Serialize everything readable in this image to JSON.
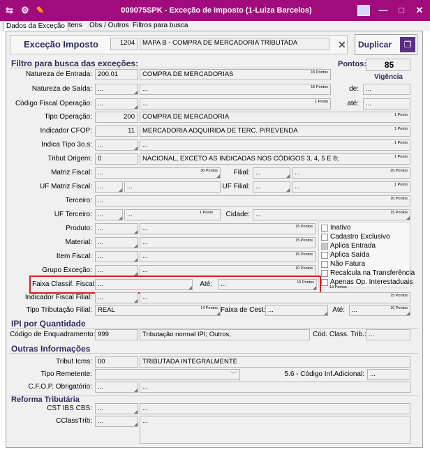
{
  "window": {
    "title": "009075SPK - Exceção de Imposto (1-Luiza Barcelos)",
    "minimize": "—",
    "maximize": "□",
    "close": "✕"
  },
  "tabs": [
    "Dados da Exceção",
    "Itens",
    "Obs / Outros",
    "Filtros para busca"
  ],
  "header": {
    "label": "Exceção Imposto",
    "code": "1204",
    "description": "MAPA B - COMPRA DE MERCADORIA TRIBUTADA",
    "clear": "✕",
    "duplicate": "Duplicar"
  },
  "filtro": {
    "title": "Filtro para busca das exceções:",
    "pontos_label": "Pontos:",
    "pontos_value": "85",
    "vigencia": "Vigência",
    "de_label": "de:",
    "de_value": "...",
    "ate_label": "até:",
    "ate_value": "...",
    "natureza_entrada": {
      "label": "Natureza de Entrada:",
      "code": "200.01",
      "desc": "COMPRA DE MERCADORIAS",
      "pts": "15 Pontos"
    },
    "natureza_saida": {
      "label": "Natureza de Saída:",
      "code": "...",
      "desc": "...",
      "pts": "15 Pontos"
    },
    "cfop": {
      "label": "Código Fiscal Operação:",
      "code": "...",
      "desc": "...",
      "pts": "1 Ponto"
    },
    "tipo_operacao": {
      "label": "Tipo Operação:",
      "code": "200",
      "desc": "COMPRA DE MERCADORIA",
      "pts": "1 Ponto"
    },
    "indicador_cfop": {
      "label": "Indicador CFOP:",
      "code": "11",
      "desc": "MERCADORIA ADQUIRIDA DE TERC. P/REVENDA",
      "pts": "1 Ponto"
    },
    "indica_tipo": {
      "label": "Indica Tipo 3o.s:",
      "code": "...",
      "desc": "...",
      "pts": "1 Ponto"
    },
    "tribut_origem": {
      "label": "Tribut Origem:",
      "code": "0",
      "desc": "NACIONAL, EXCETO AS INDICADAS NOS CÓDIGOS 3, 4, 5 E 8;",
      "pts": "1 Ponto"
    },
    "matriz_fiscal": {
      "label": "Matriz Fiscal:",
      "code": "...",
      "pts": "30 Pontos"
    },
    "filial": {
      "label": "Filial:",
      "code": "...",
      "desc": "...",
      "pts": "20 Pontos"
    },
    "uf_matriz": {
      "label": "UF Matriz Fiscal:",
      "code": "...",
      "desc": "..."
    },
    "uf_filial": {
      "label": "UF Filial:",
      "code": "...",
      "desc": "...",
      "pts": "1 Ponto"
    },
    "terceiro": {
      "label": "Terceiro:",
      "code": "...",
      "pts": "10 Pontos"
    },
    "uf_terceiro": {
      "label": "UF Terceiro:",
      "code": "...",
      "desc": "...",
      "pts": "1 Ponto"
    },
    "cidade": {
      "label": "Cidade:",
      "code": "...",
      "pts": "15 Pontos"
    },
    "produto": {
      "label": "Produto:",
      "code": "...",
      "desc": "...",
      "pts": "15 Pontos"
    },
    "material": {
      "label": "Material:",
      "code": "...",
      "desc": "...",
      "pts": "15 Pontos"
    },
    "item_fiscal": {
      "label": "Item Fiscal:",
      "code": "...",
      "desc": "...",
      "pts": "15 Pontos"
    },
    "grupo_excecao": {
      "label": "Grupo Exceção:",
      "code": "...",
      "desc": "...",
      "pts": "10 Pontos"
    },
    "faixa_classif": {
      "label": "Faixa Classif. Fiscal:",
      "code": "...",
      "ate_label": "Até:",
      "ate_value": "...",
      "pts": "10 Pontos",
      "pts2": "19 Pontos"
    },
    "indicador_filial": {
      "label": "Indicador Fiscal Filial:",
      "code": "...",
      "desc": "...",
      "pts": "15 Pontos"
    },
    "tipo_tributacao": {
      "label": "Tipo Tributação Filial:",
      "code": "REAL",
      "pts": "14 Pontos"
    },
    "faixa_cest": {
      "label": "Faixa de Cest:",
      "code": "...",
      "ate_label": "Até:",
      "ate_value": "...",
      "pts": "10 Pontos"
    },
    "checks": [
      {
        "label": "Inativo",
        "disabled": false
      },
      {
        "label": "Cadastro Exclusivo",
        "disabled": false
      },
      {
        "label": "Aplica Entrada",
        "disabled": true
      },
      {
        "label": "Aplica Saída",
        "disabled": false
      },
      {
        "label": "Não Fatura",
        "disabled": false
      },
      {
        "label": "Recalcula na Transferência",
        "disabled": false
      },
      {
        "label": "Apenas Op. Interestaduais",
        "disabled": false
      }
    ]
  },
  "ipi": {
    "title": "IPI por Quantidade",
    "label": "Código de Enquadramento:",
    "code": "999",
    "desc": "Tributação normal IPI; Outros;",
    "class_label": "Cód. Class. Trib.:",
    "class_value": "..."
  },
  "outras": {
    "title": "Outras Informações",
    "tribut_label": "Tribut Icms:",
    "tribut_code": "00",
    "tribut_desc": "TRIBUTADA INTEGRALMENTE",
    "remetente_label": "Tipo Remetente:",
    "info_label": "5.6 - Código Inf.Adicional:",
    "info_value": "...",
    "cfop_label": "C.F.O.P. Obrigatório:",
    "cfop_code": "...",
    "cfop_desc": "..."
  },
  "reforma": {
    "title": "Reforma Tributária",
    "cst_label": "CST IBS CBS:",
    "cst_code": "...",
    "cst_desc": "...",
    "cclass_label": "CClassTrib:",
    "cclass_code": "...",
    "cclass_desc": "..."
  },
  "colors": {
    "titlebar": "#a10c7c",
    "section": "#2b2b63",
    "highlight": "#e0181e"
  }
}
